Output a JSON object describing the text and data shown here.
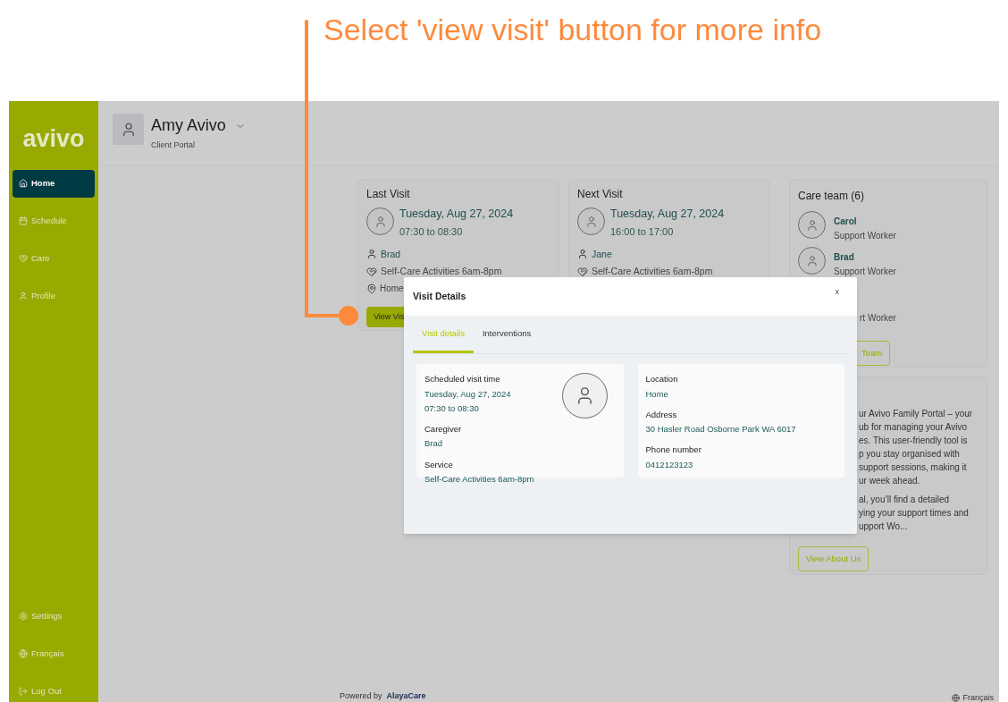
{
  "annotation": {
    "text": "Select 'view visit' button for more info"
  },
  "sidebar": {
    "logo": "avivo",
    "items": [
      {
        "label": "Home",
        "selected": true
      },
      {
        "label": "Schedule",
        "selected": false
      },
      {
        "label": "Care",
        "selected": false
      },
      {
        "label": "Profile",
        "selected": false
      }
    ],
    "bottom_items": [
      {
        "label": "Settings"
      },
      {
        "label": "Français"
      },
      {
        "label": "Log Out"
      }
    ]
  },
  "header": {
    "name": "Amy Avivo",
    "subtitle": "Client Portal"
  },
  "visit_cards": [
    {
      "title": "Last Visit",
      "date": "Tuesday, Aug 27, 2024",
      "time": "07:30 to 08:30",
      "caregiver": "Brad",
      "service": "Self-Care Activities 6am-8pm",
      "location": "Home",
      "button": "View Vis"
    },
    {
      "title": "Next Visit",
      "date": "Tuesday, Aug 27, 2024",
      "time": "16:00 to 17:00",
      "caregiver": "Jane",
      "service": "Self-Care Activities 6am-8pm"
    }
  ],
  "care_team": {
    "title": "Care team (6)",
    "members": [
      {
        "name": "Carol",
        "role": "Support Worker"
      },
      {
        "name": "Brad",
        "role": "Support Worker"
      },
      {
        "role": "rt Worker"
      }
    ],
    "button": "Team"
  },
  "about": {
    "paragraphs": [
      [
        "ur Avivo Family Portal – your",
        "ub for managing your Avivo",
        "es. This user-friendly tool is",
        "p you stay organised with",
        "support sessions, making it",
        "ur week ahead."
      ],
      [
        "al, you’ll find a detailed",
        "ying your support times and",
        "upport Wo..."
      ]
    ],
    "button": "View About Us"
  },
  "modal": {
    "title": "Visit Details",
    "close": "x",
    "tabs": [
      {
        "label": "Visit details",
        "selected": true
      },
      {
        "label": "Interventions",
        "selected": false
      }
    ],
    "left_fields": [
      {
        "label": "Scheduled visit time",
        "values": [
          "Tuesday, Aug 27, 2024",
          "07:30 to 08:30"
        ]
      },
      {
        "label": "Caregiver",
        "values": [
          "Brad"
        ]
      },
      {
        "label": "Service",
        "values": [
          "Self-Care Activities 6am-8pm"
        ]
      }
    ],
    "right_fields": [
      {
        "label": "Location",
        "values": [
          "Home"
        ]
      },
      {
        "label": "Address",
        "values": [
          "30 Hasler Road Osborne Park WA 6017"
        ]
      },
      {
        "label": "Phone number",
        "values": [
          "0412123123"
        ]
      }
    ]
  },
  "footer": {
    "powered_by": "Powered by",
    "brand": "AlayaCare",
    "language": "Français"
  }
}
